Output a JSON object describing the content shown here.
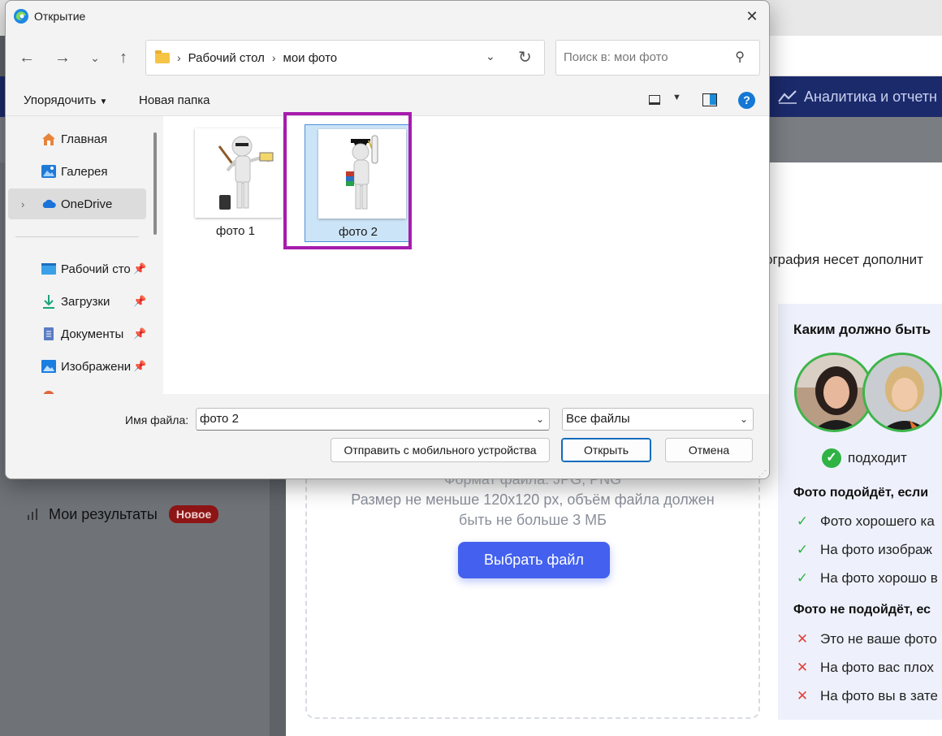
{
  "background": {
    "nav_item": "Аналитика и отчетн",
    "intro_text": "ография несет дополнит",
    "my_results": "Мои результаты",
    "my_results_badge": "Новое",
    "upload": {
      "format_text": "Формат файла: JPG, PNG",
      "size_text_1": "Размер не меньше 120x120 px, объём файла должен",
      "size_text_2": "быть не больше 3 МБ",
      "choose_button": "Выбрать файл"
    },
    "requirements": {
      "title": "Каким должно быть",
      "ok_label": "подходит",
      "good_heading": "Фото подойдёт, если",
      "good_items": [
        "Фото хорошего ка",
        "На фото изображ",
        "На фото хорошо в"
      ],
      "bad_heading": "Фото не подойдёт, ес",
      "bad_items": [
        "Это не ваше фото",
        "На фото вас плох",
        "На фото вы в зате"
      ]
    },
    "colors": {
      "nav": "#1b2a6b",
      "button": "#4361ee",
      "check": "#2fb344",
      "cross": "#e0413a",
      "badge": "#8e1515"
    }
  },
  "dialog": {
    "title": "Открытие",
    "breadcrumb": [
      "Рабочий стол",
      "мои фото"
    ],
    "search_placeholder": "Поиск в: мои фото",
    "toolbar": {
      "organize": "Упорядочить",
      "new_folder": "Новая папка"
    },
    "nav_items": [
      {
        "label": "Главная",
        "icon": "home-icon"
      },
      {
        "label": "Галерея",
        "icon": "gallery-icon"
      },
      {
        "label": "OneDrive",
        "icon": "cloud-icon",
        "selected": true
      },
      {
        "label": "Рабочий сто",
        "icon": "desktop-icon",
        "pinned": true
      },
      {
        "label": "Загрузки",
        "icon": "download-icon",
        "pinned": true
      },
      {
        "label": "Документы",
        "icon": "document-icon",
        "pinned": true
      },
      {
        "label": "Изображени",
        "icon": "image-icon",
        "pinned": true
      }
    ],
    "files": [
      {
        "name": "фото 1",
        "selected": false
      },
      {
        "name": "фото 2",
        "selected": true
      }
    ],
    "filename_label": "Имя файла:",
    "filename_value": "фото 2",
    "filetype": "Все файлы",
    "buttons": {
      "mobile": "Отправить с мобильного устройства",
      "open": "Открыть",
      "cancel": "Отмена"
    },
    "highlight_color": "#a61cad"
  }
}
